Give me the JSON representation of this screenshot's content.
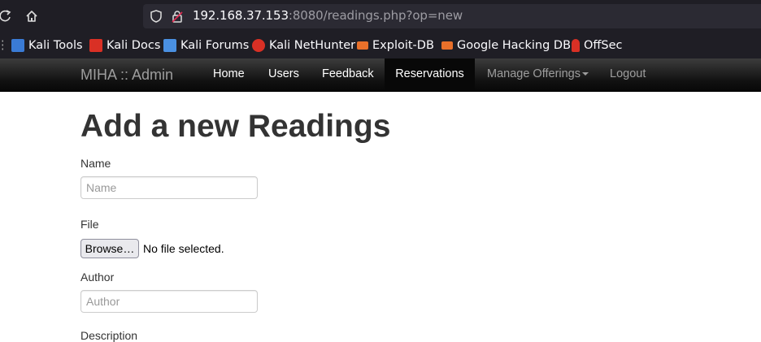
{
  "browser": {
    "url": {
      "host": "192.168.37.153",
      "rest": ":8080/readings.php?op=new"
    },
    "bookmarks": [
      {
        "label": "Kali Tools",
        "icon": "kali-tools-icon",
        "color": "#3a7bd5"
      },
      {
        "label": "Kali Docs",
        "icon": "kali-docs-icon",
        "color": "#d93025"
      },
      {
        "label": "Kali Forums",
        "icon": "kali-forums-icon",
        "color": "#4a90e2"
      },
      {
        "label": "Kali NetHunter",
        "icon": "kali-nethunter-icon",
        "color": "#d93025"
      },
      {
        "label": "Exploit-DB",
        "icon": "exploit-db-icon",
        "color": "#e8702a"
      },
      {
        "label": "Google Hacking DB",
        "icon": "ghdb-icon",
        "color": "#e8702a"
      },
      {
        "label": "OffSec",
        "icon": "offsec-icon",
        "color": "#d93025"
      }
    ]
  },
  "navbar": {
    "brand": "MIHA :: Admin",
    "items": [
      {
        "label": "Home"
      },
      {
        "label": "Users"
      },
      {
        "label": "Feedback"
      },
      {
        "label": "Reservations"
      },
      {
        "label": "Manage Offerings"
      },
      {
        "label": "Logout"
      }
    ]
  },
  "form": {
    "title": "Add a new Readings",
    "name": {
      "label": "Name",
      "placeholder": "Name"
    },
    "file": {
      "label": "File",
      "button": "Browse…",
      "status": "No file selected."
    },
    "author": {
      "label": "Author",
      "placeholder": "Author"
    },
    "description": {
      "label": "Description"
    }
  }
}
